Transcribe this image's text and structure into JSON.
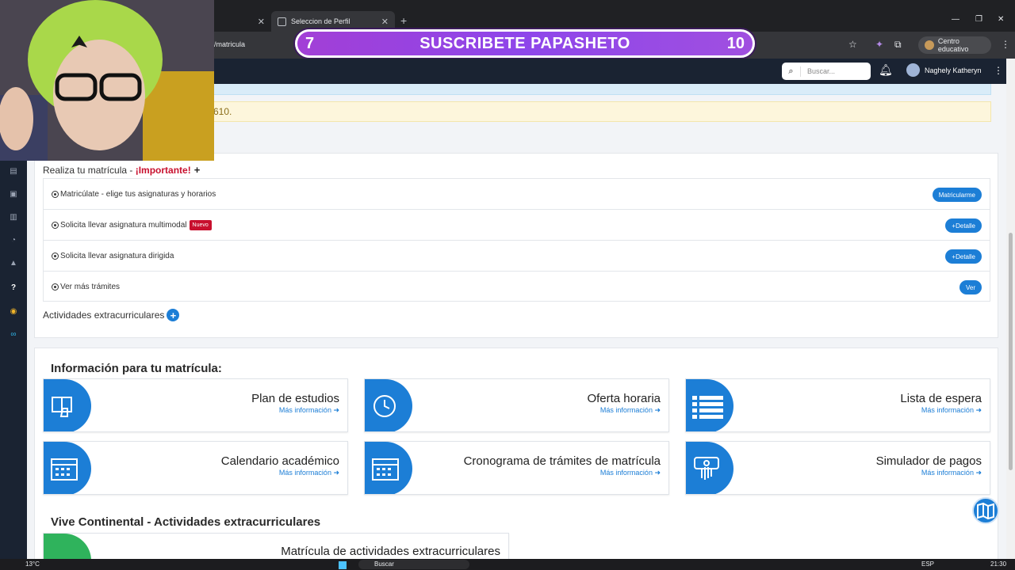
{
  "browser": {
    "tab_active": "Seleccion de Perfil",
    "url_fragment": "/matricula",
    "profile_chip": "Centro educativo"
  },
  "banner": {
    "left_number": "7",
    "message": "SUSCRIBETE PAPASHETO",
    "right_number": "10"
  },
  "header": {
    "search_placeholder": "Buscar...",
    "user_name": "Naghely Katheryn"
  },
  "alerts": {
    "yellow_text": "610."
  },
  "enrollment": {
    "title": "Realiza tu matrícula - ",
    "important": "¡Importante!",
    "plus": "+",
    "rows": [
      {
        "label": "Matricúlate - elige tus asignaturas y horarios",
        "button": "Matricularme",
        "badge": ""
      },
      {
        "label": "Solicita llevar asignatura multimodal",
        "button": "+Detalle",
        "badge": "Nuevo"
      },
      {
        "label": "Solicita llevar asignatura dirigida",
        "button": "+Detalle",
        "badge": ""
      },
      {
        "label": "Ver más trámites",
        "button": "Ver",
        "badge": ""
      }
    ],
    "extracurricular": "Actividades extracurriculares",
    "extra_plus": "+"
  },
  "info": {
    "heading": "Información para tu matrícula:",
    "more_label": "Más información ➜",
    "tiles": [
      {
        "title": "Plan de estudios",
        "icon": "book-hand-icon"
      },
      {
        "title": "Oferta horaria",
        "icon": "clock-icon"
      },
      {
        "title": "Lista de espera",
        "icon": "list-icon"
      },
      {
        "title": "Calendario académico",
        "icon": "calendar-icon"
      },
      {
        "title": "Cronograma de trámites de matrícula",
        "icon": "calendar-icon"
      },
      {
        "title": "Simulador de pagos",
        "icon": "payment-hand-icon"
      }
    ]
  },
  "vive": {
    "heading": "Vive Continental - Actividades extracurriculares",
    "tile_title": "Matrícula de actividades extracurriculares"
  },
  "taskbar": {
    "weather": "13°C",
    "search": "Buscar",
    "lang": "ESP",
    "time": "21:30"
  },
  "colors": {
    "accent": "#1c7ed6",
    "danger": "#c8102e",
    "header": "#1a2332",
    "banner": "#8e46ea"
  }
}
